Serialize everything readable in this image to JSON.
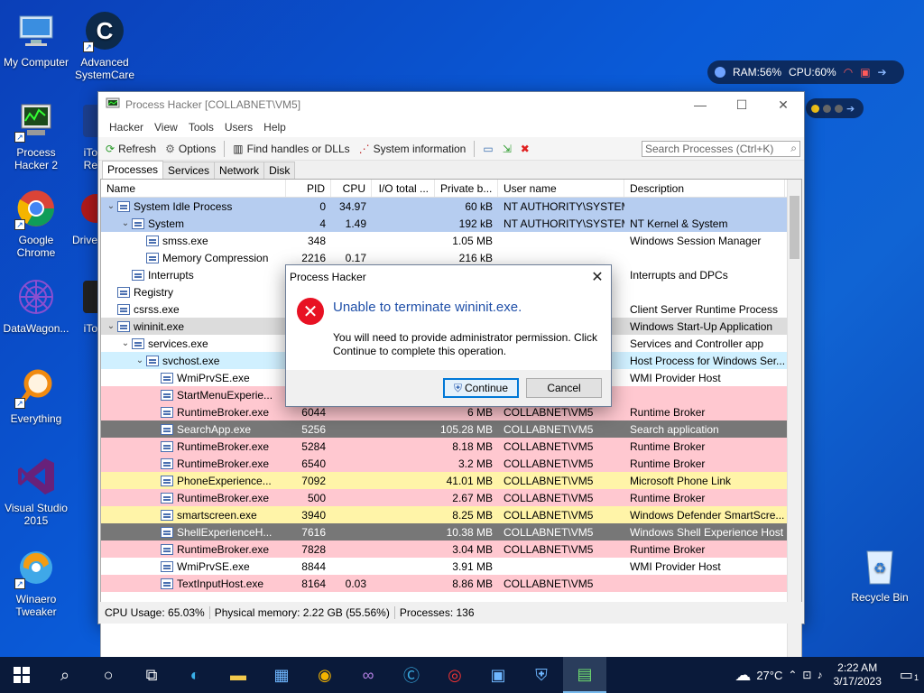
{
  "desktop": {
    "icons": [
      {
        "label": "My Computer"
      },
      {
        "label": "Advanced SystemCare"
      },
      {
        "label": "Process Hacker 2"
      },
      {
        "label": "iTo Re"
      },
      {
        "label": "Google Chrome"
      },
      {
        "label": "Drive"
      },
      {
        "label": "DataWagon..."
      },
      {
        "label": "iTo"
      },
      {
        "label": "Everything"
      },
      {
        "label": "Visual Studio 2015"
      },
      {
        "label": "Winaero Tweaker"
      },
      {
        "label": "Recycle Bin"
      }
    ]
  },
  "widget": {
    "ram": "RAM:56%",
    "cpu": "CPU:60%"
  },
  "window": {
    "title": "Process Hacker [COLLABNET\\VM5]",
    "menu": [
      "Hacker",
      "View",
      "Tools",
      "Users",
      "Help"
    ],
    "toolbar": {
      "refresh": "Refresh",
      "options": "Options",
      "find": "Find handles or DLLs",
      "sysinfo": "System information",
      "search_placeholder": "Search Processes (Ctrl+K)"
    },
    "tabs": [
      "Processes",
      "Services",
      "Network",
      "Disk"
    ],
    "columns": [
      "Name",
      "PID",
      "CPU",
      "I/O total ...",
      "Private b...",
      "User name",
      "Description"
    ],
    "rows": [
      {
        "indent": 0,
        "exp": "v",
        "name": "System Idle Process",
        "pid": "0",
        "cpu": "34.97",
        "io": "",
        "priv": "60 kB",
        "user": "NT AUTHORITY\\SYSTEM",
        "desc": "",
        "bg": "#b6cdf0"
      },
      {
        "indent": 1,
        "exp": "v",
        "name": "System",
        "pid": "4",
        "cpu": "1.49",
        "io": "",
        "priv": "192 kB",
        "user": "NT AUTHORITY\\SYSTEM",
        "desc": "NT Kernel & System",
        "bg": "#b6cdf0"
      },
      {
        "indent": 2,
        "exp": "",
        "name": "smss.exe",
        "pid": "348",
        "cpu": "",
        "io": "",
        "priv": "1.05 MB",
        "user": "",
        "desc": "Windows Session Manager",
        "bg": "#ffffff"
      },
      {
        "indent": 2,
        "exp": "",
        "name": "Memory Compression",
        "pid": "2216",
        "cpu": "0.17",
        "io": "",
        "priv": "216 kB",
        "user": "",
        "desc": "",
        "bg": "#ffffff"
      },
      {
        "indent": 1,
        "exp": "",
        "name": "Interrupts",
        "pid": "",
        "cpu": "",
        "io": "",
        "priv": "",
        "user": "",
        "desc": "Interrupts and DPCs",
        "bg": "#ffffff"
      },
      {
        "indent": 0,
        "exp": "",
        "name": "Registry",
        "pid": "",
        "cpu": "",
        "io": "",
        "priv": "",
        "user": "",
        "desc": "",
        "bg": "#ffffff"
      },
      {
        "indent": 0,
        "exp": "",
        "name": "csrss.exe",
        "pid": "",
        "cpu": "",
        "io": "",
        "priv": "",
        "user": "",
        "desc": "Client Server Runtime Process",
        "bg": "#ffffff"
      },
      {
        "indent": 0,
        "exp": "v",
        "name": "wininit.exe",
        "pid": "",
        "cpu": "",
        "io": "",
        "priv": "",
        "user": "",
        "desc": "Windows Start-Up Application",
        "bg": "#dcdcdc"
      },
      {
        "indent": 1,
        "exp": "v",
        "name": "services.exe",
        "pid": "",
        "cpu": "",
        "io": "",
        "priv": "",
        "user": "",
        "desc": "Services and Controller app",
        "bg": "#ffffff"
      },
      {
        "indent": 2,
        "exp": "v",
        "name": "svchost.exe",
        "pid": "",
        "cpu": "",
        "io": "",
        "priv": "",
        "user": "",
        "desc": "Host Process for Windows Ser...",
        "bg": "#d0f0ff"
      },
      {
        "indent": 3,
        "exp": "",
        "name": "WmiPrvSE.exe",
        "pid": "",
        "cpu": "",
        "io": "",
        "priv": "",
        "user": "",
        "desc": "WMI Provider Host",
        "bg": "#ffffff"
      },
      {
        "indent": 3,
        "exp": "",
        "name": "StartMenuExperie...",
        "pid": "",
        "cpu": "",
        "io": "",
        "priv": "",
        "user": "",
        "desc": "",
        "bg": "#ffc8d0"
      },
      {
        "indent": 3,
        "exp": "",
        "name": "RuntimeBroker.exe",
        "pid": "6044",
        "cpu": "",
        "io": "",
        "priv": "6 MB",
        "user": "COLLABNET\\VM5",
        "desc": "Runtime Broker",
        "bg": "#ffc8d0"
      },
      {
        "indent": 3,
        "exp": "",
        "name": "SearchApp.exe",
        "pid": "5256",
        "cpu": "",
        "io": "",
        "priv": "105.28 MB",
        "user": "COLLABNET\\VM5",
        "desc": "Search application",
        "bg": "#777777"
      },
      {
        "indent": 3,
        "exp": "",
        "name": "RuntimeBroker.exe",
        "pid": "5284",
        "cpu": "",
        "io": "",
        "priv": "8.18 MB",
        "user": "COLLABNET\\VM5",
        "desc": "Runtime Broker",
        "bg": "#ffc8d0"
      },
      {
        "indent": 3,
        "exp": "",
        "name": "RuntimeBroker.exe",
        "pid": "6540",
        "cpu": "",
        "io": "",
        "priv": "3.2 MB",
        "user": "COLLABNET\\VM5",
        "desc": "Runtime Broker",
        "bg": "#ffc8d0"
      },
      {
        "indent": 3,
        "exp": "",
        "name": "PhoneExperience...",
        "pid": "7092",
        "cpu": "",
        "io": "",
        "priv": "41.01 MB",
        "user": "COLLABNET\\VM5",
        "desc": "Microsoft Phone Link",
        "bg": "#fff4a8"
      },
      {
        "indent": 3,
        "exp": "",
        "name": "RuntimeBroker.exe",
        "pid": "500",
        "cpu": "",
        "io": "",
        "priv": "2.67 MB",
        "user": "COLLABNET\\VM5",
        "desc": "Runtime Broker",
        "bg": "#ffc8d0"
      },
      {
        "indent": 3,
        "exp": "",
        "name": "smartscreen.exe",
        "pid": "3940",
        "cpu": "",
        "io": "",
        "priv": "8.25 MB",
        "user": "COLLABNET\\VM5",
        "desc": "Windows Defender SmartScre...",
        "bg": "#fff4a8"
      },
      {
        "indent": 3,
        "exp": "",
        "name": "ShellExperienceH...",
        "pid": "7616",
        "cpu": "",
        "io": "",
        "priv": "10.38 MB",
        "user": "COLLABNET\\VM5",
        "desc": "Windows Shell Experience Host",
        "bg": "#777777"
      },
      {
        "indent": 3,
        "exp": "",
        "name": "RuntimeBroker.exe",
        "pid": "7828",
        "cpu": "",
        "io": "",
        "priv": "3.04 MB",
        "user": "COLLABNET\\VM5",
        "desc": "Runtime Broker",
        "bg": "#ffc8d0"
      },
      {
        "indent": 3,
        "exp": "",
        "name": "WmiPrvSE.exe",
        "pid": "8844",
        "cpu": "",
        "io": "",
        "priv": "3.91 MB",
        "user": "",
        "desc": "WMI Provider Host",
        "bg": "#ffffff"
      },
      {
        "indent": 3,
        "exp": "",
        "name": "TextInputHost.exe",
        "pid": "8164",
        "cpu": "0.03",
        "io": "",
        "priv": "8.86 MB",
        "user": "COLLABNET\\VM5",
        "desc": "",
        "bg": "#ffc8d0"
      }
    ],
    "status": {
      "cpu": "CPU Usage: 65.03%",
      "mem": "Physical memory: 2.22 GB (55.56%)",
      "procs": "Processes: 136"
    }
  },
  "dialog": {
    "title": "Process Hacker",
    "heading": "Unable to terminate wininit.exe.",
    "message": "You will need to provide administrator permission. Click Continue to complete this operation.",
    "continue": "Continue",
    "cancel": "Cancel"
  },
  "taskbar": {
    "temperature": "27°C",
    "time": "2:22 AM",
    "date": "3/17/2023",
    "notifications": "1"
  },
  "colors": {
    "accent": "#0078d7",
    "error": "#e81123",
    "heading": "#1f4fa8"
  }
}
